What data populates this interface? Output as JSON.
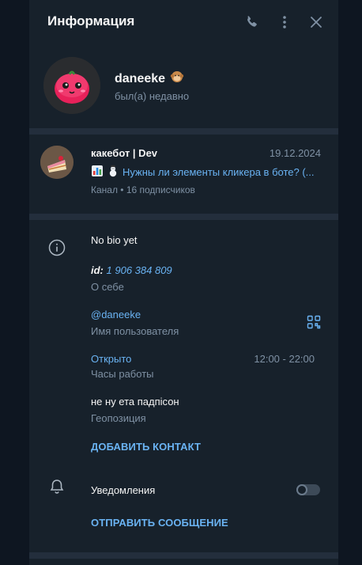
{
  "header": {
    "title": "Информация"
  },
  "profile": {
    "name": "daneeke",
    "status": "был(а) недавно"
  },
  "channel": {
    "name": "какебот | Dev",
    "date": "19.12.2024",
    "message": "Нужны ли элементы кликера в боте? (...",
    "subtitle": "Канал • 16 подписчиков"
  },
  "info": {
    "bio": "No bio yet",
    "id_prefix": "id:",
    "id_value": "1 906 384 809",
    "id_label": "О себе",
    "username": "@daneeke",
    "username_label": "Имя пользователя",
    "hours_status": "Открыто",
    "hours_value": "12:00 - 22:00",
    "hours_label": "Часы работы",
    "location": "не ну ета падпісон",
    "location_label": "Геопозиция",
    "add_contact": "ДОБАВИТЬ КОНТАКТ",
    "notifications_label": "Уведомления",
    "notifications_on": false,
    "send_message": "ОТПРАВИТЬ СООБЩЕНИЕ"
  },
  "colors": {
    "accent": "#6ab3f3",
    "panel": "#17212b",
    "background": "#0e1621",
    "muted": "#7f91a4"
  }
}
